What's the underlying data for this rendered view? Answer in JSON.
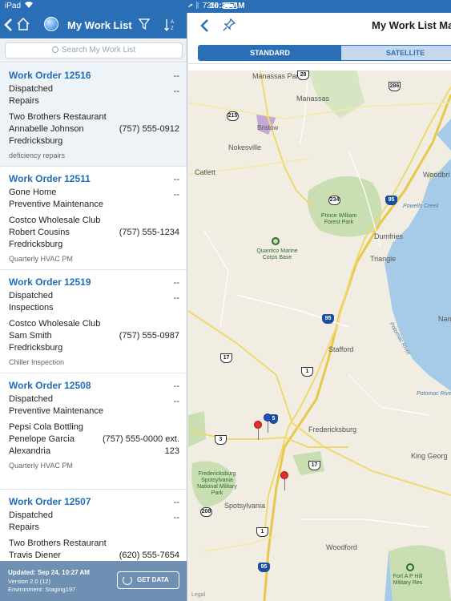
{
  "status_bar": {
    "carrier": "iPad",
    "time": "10:29 AM",
    "battery_text": "73%",
    "battery_level": 0.73
  },
  "left_nav": {
    "title": "My Work List"
  },
  "search": {
    "placeholder": "Search My Work List"
  },
  "work_orders": [
    {
      "title": "Work Order 12516",
      "status": "Dispatched",
      "type": "Repairs",
      "dash1": "--",
      "dash2": "--",
      "site": "Two Brothers Restaurant",
      "contact": "Annabelle Johnson",
      "phone": "(757) 555-0912",
      "city": "Fredricksburg",
      "note": "deficiency repairs"
    },
    {
      "title": "Work Order 12511",
      "status": "Gone Home",
      "type": "Preventive Maintenance",
      "dash1": "--",
      "dash2": "--",
      "site": "Costco Wholesale Club",
      "contact": "Robert Cousins",
      "phone": "(757) 555-1234",
      "city": "Fredricksburg",
      "note": "Quarterly HVAC PM"
    },
    {
      "title": "Work Order 12519",
      "status": "Dispatched",
      "type": "Inspections",
      "dash1": "--",
      "dash2": "--",
      "site": "Costco Wholesale Club",
      "contact": "Sam Smith",
      "phone": "(757) 555-0987",
      "city": "Fredricksburg",
      "note": "Chiller Inspection"
    },
    {
      "title": "Work Order 12508",
      "status": "Dispatched",
      "type": "Preventive Maintenance",
      "dash1": "--",
      "dash2": "--",
      "site": "Pepsi Cola Bottling",
      "contact": "Penelope Garcia",
      "phone": "(757) 555-0000 ext.",
      "phone2": "123",
      "city": "Alexandria",
      "note": "Quarterly HVAC PM"
    },
    {
      "title": "Work Order 12507",
      "status": "Dispatched",
      "type": "Repairs",
      "dash1": "--",
      "dash2": "--",
      "site": "Two Brothers Restaurant",
      "contact": "Travis Diener",
      "phone": "(620) 555-7654"
    }
  ],
  "footer": {
    "updated": "Updated: Sep 24, 10:27 AM",
    "version": "Version 2.0 (12)",
    "environment": "Environment: Staging197",
    "get_data": "GET DATA"
  },
  "right_nav": {
    "title": "My Work List Map"
  },
  "map_tabs": {
    "standard": "STANDARD",
    "satellite": "SATELLITE"
  },
  "map": {
    "legal": "Legal",
    "places": {
      "manassas_park": "Manassas Park",
      "manassas": "Manassas",
      "bristow": "Bristow",
      "nokesville": "Nokesville",
      "catlett": "Catlett",
      "woodbridge": "Woodbri",
      "powells_creek": "Powells Creek",
      "prince_william": "Prince William Forest Park",
      "dumfries": "Dumfries",
      "quantico": "Quantico Marine Corps Base",
      "triangle": "Triangle",
      "potomac_river": "Potomac River",
      "potomac_river2": "Potomac River",
      "nan": "Nan",
      "stafford": "Stafford",
      "fredericksburg": "Fredericksburg",
      "king_george": "King Georg",
      "spotsylvania_park": "Fredericksburg Spotsylvania National Military Park",
      "spotsylvania": "Spotsylvania",
      "woodford": "Woodford",
      "fort_ap_hill": "Fort A P Hill Military Res"
    },
    "shields": {
      "s28": "28",
      "s286": "286",
      "s215": "215",
      "s234": "234",
      "s95a": "95",
      "s95b": "95",
      "s17a": "17",
      "s1a": "1",
      "s3": "3",
      "s17b": "17",
      "s208": "208",
      "s1b": "1",
      "s95c": "95",
      "s5": "5"
    }
  }
}
